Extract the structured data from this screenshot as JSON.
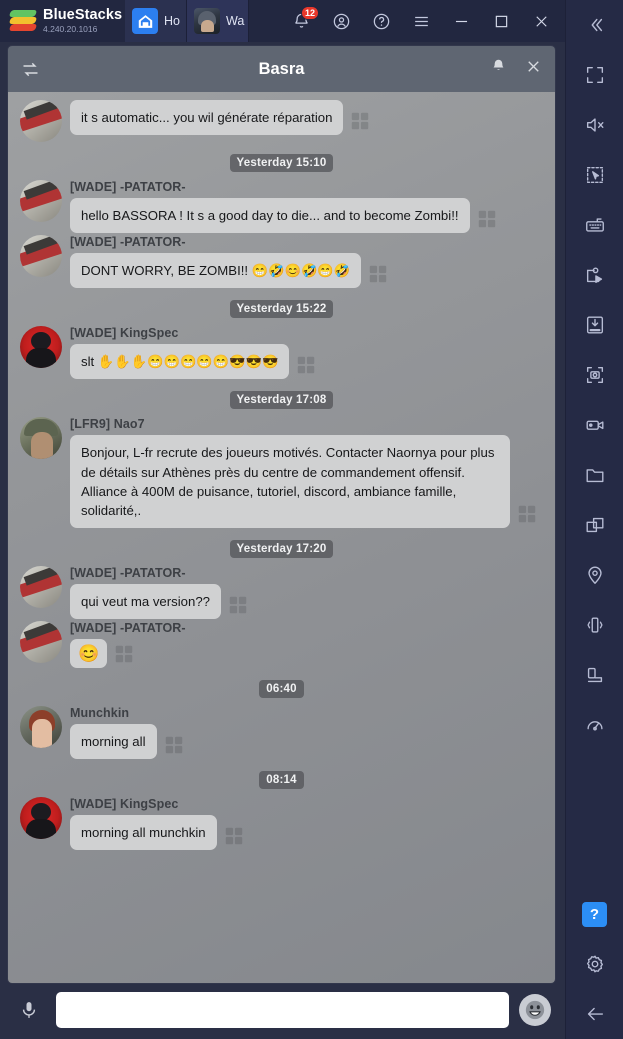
{
  "titlebar": {
    "brand": "BlueStacks",
    "version": "4.240.20.1016",
    "tabs": [
      {
        "label": "Ho",
        "icon": "home-icon",
        "active": false
      },
      {
        "label": "Wa",
        "icon": "game-thumbnail",
        "active": true
      }
    ],
    "notification_count": "12",
    "buttons": {
      "notifications": "notification-bell-icon",
      "account": "account-icon",
      "help": "help-icon",
      "menu": "hamburger-menu-icon",
      "minimize": "minimize-icon",
      "maximize": "maximize-icon",
      "close": "close-icon"
    }
  },
  "chat": {
    "title": "Basra",
    "left_icon": "switch-channel-icon",
    "bell_icon": "bell-icon",
    "close_icon": "close-icon",
    "items": [
      {
        "kind": "message",
        "nick": "",
        "avatar": "patator",
        "text": "it s automatic... you wil générate réparation",
        "show_nick": false
      },
      {
        "kind": "time",
        "text": "Yesterday 15:10"
      },
      {
        "kind": "message",
        "nick": "[WADE] -PATATOR-",
        "avatar": "patator",
        "text": "hello BASSORA ! It s a good day to die... and to become Zombi!!",
        "show_nick": true
      },
      {
        "kind": "message",
        "nick": "[WADE] -PATATOR-",
        "avatar": "patator",
        "text": "DONT WORRY, BE ZOMBI!! 😁🤣😊🤣😁🤣",
        "show_nick": true
      },
      {
        "kind": "time",
        "text": "Yesterday 15:22"
      },
      {
        "kind": "message",
        "nick": "[WADE] KingSpec",
        "avatar": "kingspec",
        "text": "slt ✋✋✋😁😁😁😁😁😎😎😎",
        "show_nick": true
      },
      {
        "kind": "time",
        "text": "Yesterday 17:08"
      },
      {
        "kind": "message",
        "nick": "[LFR9] Nao7",
        "avatar": "nao7",
        "text": "Bonjour, L-fr recrute des joueurs motivés.  Contacter Naornya pour plus de détails sur Athènes près du centre de commandement offensif. Alliance à 400M de puisance, tutoriel, discord, ambiance famille, solidarité,.",
        "show_nick": true
      },
      {
        "kind": "time",
        "text": "Yesterday 17:20"
      },
      {
        "kind": "message",
        "nick": "[WADE] -PATATOR-",
        "avatar": "patator",
        "text": "qui veut ma version??",
        "show_nick": true
      },
      {
        "kind": "message",
        "nick": "[WADE] -PATATOR-",
        "avatar": "patator",
        "text": "😊",
        "show_nick": true,
        "emoji_only": true
      },
      {
        "kind": "time",
        "text": "06:40"
      },
      {
        "kind": "message",
        "nick": "Munchkin",
        "avatar": "munchkin",
        "text": "morning all",
        "show_nick": true
      },
      {
        "kind": "time",
        "text": "08:14"
      },
      {
        "kind": "message",
        "nick": "[WADE] KingSpec",
        "avatar": "kingspec",
        "text": "morning all munchkin",
        "show_nick": true
      }
    ]
  },
  "input": {
    "mic_icon": "microphone-icon",
    "value": "",
    "placeholder": "",
    "emoji_icon": "emoji-icon"
  },
  "sidebar": {
    "items": [
      {
        "name": "collapse-sidebar-button",
        "icon": "chevron-double-left-icon"
      },
      {
        "name": "fullscreen-button",
        "icon": "fullscreen-icon"
      },
      {
        "name": "mute-button",
        "icon": "speaker-mute-icon"
      },
      {
        "name": "multi-select-button",
        "icon": "marquee-select-icon"
      },
      {
        "name": "keymapping-button",
        "icon": "keyboard-icon"
      },
      {
        "name": "macro-recorder-button",
        "icon": "macro-play-icon"
      },
      {
        "name": "install-apk-button",
        "icon": "apk-install-icon"
      },
      {
        "name": "screenshot-button",
        "icon": "screenshot-icon"
      },
      {
        "name": "record-screen-button",
        "icon": "video-camera-icon"
      },
      {
        "name": "media-manager-button",
        "icon": "folder-icon"
      },
      {
        "name": "multi-instance-button",
        "icon": "copy-windows-icon"
      },
      {
        "name": "location-button",
        "icon": "location-pin-icon"
      },
      {
        "name": "shake-button",
        "icon": "shake-device-icon"
      },
      {
        "name": "rotate-button",
        "icon": "rotate-screen-icon"
      },
      {
        "name": "eco-mode-button",
        "icon": "gauge-icon"
      }
    ],
    "bottom": [
      {
        "name": "help-button",
        "icon": "question-mark-icon",
        "label": "?"
      },
      {
        "name": "settings-button",
        "icon": "gear-icon"
      },
      {
        "name": "back-button",
        "icon": "arrow-left-icon"
      }
    ]
  }
}
